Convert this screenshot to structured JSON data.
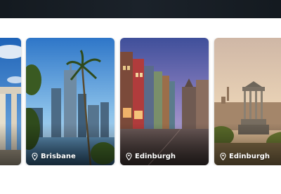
{
  "carousel": {
    "cards": [
      {
        "city": "",
        "icon": "location-pin-icon"
      },
      {
        "city": "Brisbane",
        "icon": "location-pin-icon"
      },
      {
        "city": "Edinburgh",
        "icon": "location-pin-icon"
      },
      {
        "city": "Edinburgh",
        "icon": "location-pin-icon"
      }
    ]
  },
  "colors": {
    "top_bar": "#161c22",
    "caption_text": "#ffffff"
  }
}
